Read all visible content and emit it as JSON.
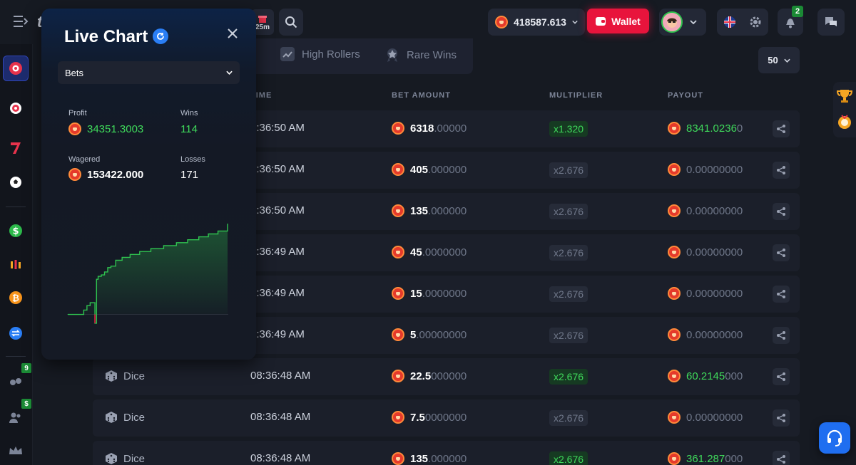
{
  "header": {
    "brand_initial": "t",
    "promo_timer": "25m",
    "balance": "418587.613",
    "wallet_label": "Wallet",
    "notifications_count": "2"
  },
  "sidebar": {
    "badges": [
      "9",
      "$"
    ]
  },
  "tabs": [
    {
      "label": "High Rollers"
    },
    {
      "label": "Rare Wins"
    }
  ],
  "per_page": "50",
  "table": {
    "columns": [
      "TIME",
      "BET AMOUNT",
      "MULTIPLIER",
      "PAYOUT"
    ],
    "rows": [
      {
        "game": "",
        "time": "8:36:50 AM",
        "bet_strong": "6318",
        "bet_dim": ".00000",
        "multiplier": "x1.320",
        "win": true,
        "pay_strong": "8341.0236",
        "pay_dim": "0"
      },
      {
        "game": "",
        "time": "8:36:50 AM",
        "bet_strong": "405",
        "bet_dim": ".000000",
        "multiplier": "x2.676",
        "win": false,
        "pay_strong": "",
        "pay_dim": "0.00000000"
      },
      {
        "game": "",
        "time": "8:36:50 AM",
        "bet_strong": "135",
        "bet_dim": ".000000",
        "multiplier": "x2.676",
        "win": false,
        "pay_strong": "",
        "pay_dim": "0.00000000"
      },
      {
        "game": "",
        "time": "8:36:49 AM",
        "bet_strong": "45",
        "bet_dim": ".0000000",
        "multiplier": "x2.676",
        "win": false,
        "pay_strong": "",
        "pay_dim": "0.00000000"
      },
      {
        "game": "",
        "time": "8:36:49 AM",
        "bet_strong": "15",
        "bet_dim": ".0000000",
        "multiplier": "x2.676",
        "win": false,
        "pay_strong": "",
        "pay_dim": "0.00000000"
      },
      {
        "game": "",
        "time": "8:36:49 AM",
        "bet_strong": "5",
        "bet_dim": ".00000000",
        "multiplier": "x2.676",
        "win": false,
        "pay_strong": "",
        "pay_dim": "0.00000000"
      },
      {
        "game": "Dice",
        "time": "08:36:48 AM",
        "bet_strong": "22.5",
        "bet_dim": "000000",
        "multiplier": "x2.676",
        "win": true,
        "pay_strong": "60.2145",
        "pay_dim": "000"
      },
      {
        "game": "Dice",
        "time": "08:36:48 AM",
        "bet_strong": "7.5",
        "bet_dim": "0000000",
        "multiplier": "x2.676",
        "win": false,
        "pay_strong": "",
        "pay_dim": "0.00000000"
      },
      {
        "game": "Dice",
        "time": "08:36:48 AM",
        "bet_strong": "135",
        "bet_dim": ".000000",
        "multiplier": "x2.676",
        "win": true,
        "pay_strong": "361.287",
        "pay_dim": "000"
      }
    ]
  },
  "live_chart": {
    "title": "Live Chart",
    "select_value": "Bets",
    "profit_label": "Profit",
    "profit_value": "34351.3003",
    "wins_label": "Wins",
    "wins_value": "114",
    "wagered_label": "Wagered",
    "wagered_value": "153422.000",
    "losses_label": "Losses",
    "losses_value": "171"
  },
  "chart_data": {
    "type": "line",
    "title": "",
    "xlabel": "",
    "ylabel": "",
    "grid": false,
    "x": [
      0,
      6,
      10,
      12,
      14,
      17,
      18,
      19,
      21,
      23,
      25,
      27,
      30,
      34,
      39,
      45,
      52,
      60,
      68,
      75,
      82,
      88,
      94,
      100
    ],
    "values": [
      0,
      0,
      1.5,
      3,
      4,
      -3,
      12,
      13,
      13.5,
      14.5,
      16,
      16.5,
      18.5,
      19.5,
      20.5,
      21.5,
      22.5,
      23.5,
      24.5,
      25.5,
      26.5,
      27.5,
      28.5,
      31
    ],
    "ylim": [
      -4,
      32
    ],
    "colors": {
      "positive": "#2fc24f",
      "negative": "#e8143c"
    }
  },
  "colors": {
    "accent_blue": "#2a6bf0",
    "wallet_red": "#e8143c",
    "win_green": "#3fd95b",
    "panel_bg": "#151a25"
  },
  "icons": {
    "menu": "menu-icon",
    "search": "search-icon",
    "gear": "gear-icon",
    "bell": "bell-icon",
    "chat": "chat-icon",
    "share": "share-icon",
    "dice": "dice-icon",
    "close": "close-icon",
    "refresh": "refresh-icon",
    "support": "headset-icon"
  }
}
